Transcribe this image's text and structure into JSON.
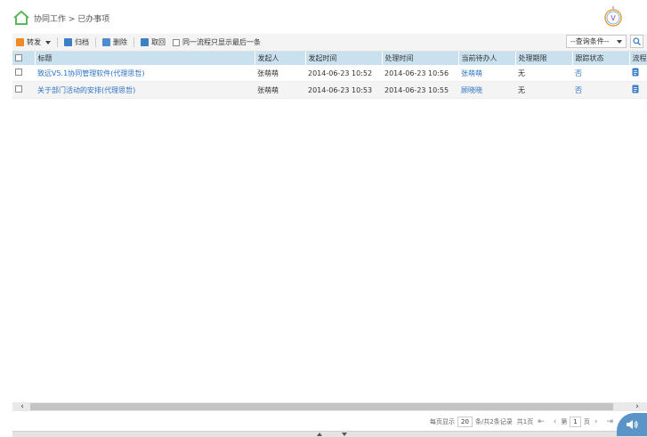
{
  "breadcrumb": {
    "home_icon": "home-icon",
    "path": "协同工作 > 已办事项"
  },
  "logo_icon": "v-badge-logo",
  "toolbar": {
    "forward_label": "转发",
    "archive_label": "归档",
    "delete_label": "删除",
    "retract_label": "取回",
    "same_flow_label": "同一流程只显示最后一条",
    "query_select": "--查询条件--"
  },
  "table": {
    "headers": [
      "标题",
      "发起人",
      "发起时间",
      "处理时间",
      "当前待办人",
      "处理期限",
      "跟踪状态",
      "流程日"
    ],
    "rows": [
      {
        "title": "致远V5.1协同管理软件(代理思哲)",
        "sender": "张萌萌",
        "start_time": "2014-06-23 10:52",
        "handle_time": "2014-06-23 10:56",
        "current_handler": "张萌萌",
        "deadline": "无",
        "tracking": "否"
      },
      {
        "title": "关于部门活动的安排(代理思哲)",
        "sender": "张萌萌",
        "start_time": "2014-06-23 10:53",
        "handle_time": "2014-06-23 10:55",
        "current_handler": "顾晓晓",
        "deadline": "无",
        "tracking": "否"
      }
    ]
  },
  "pager": {
    "per_page_label": "每页显示",
    "per_page_value": "20",
    "summary": "条/共2条记录",
    "total_pages": "共1页",
    "page_prefix": "第",
    "page_value": "1",
    "page_suffix": "页"
  },
  "colors": {
    "header_bg": "#c9e1ee",
    "link": "#2a72c4",
    "home_green": "#5cb85c"
  }
}
